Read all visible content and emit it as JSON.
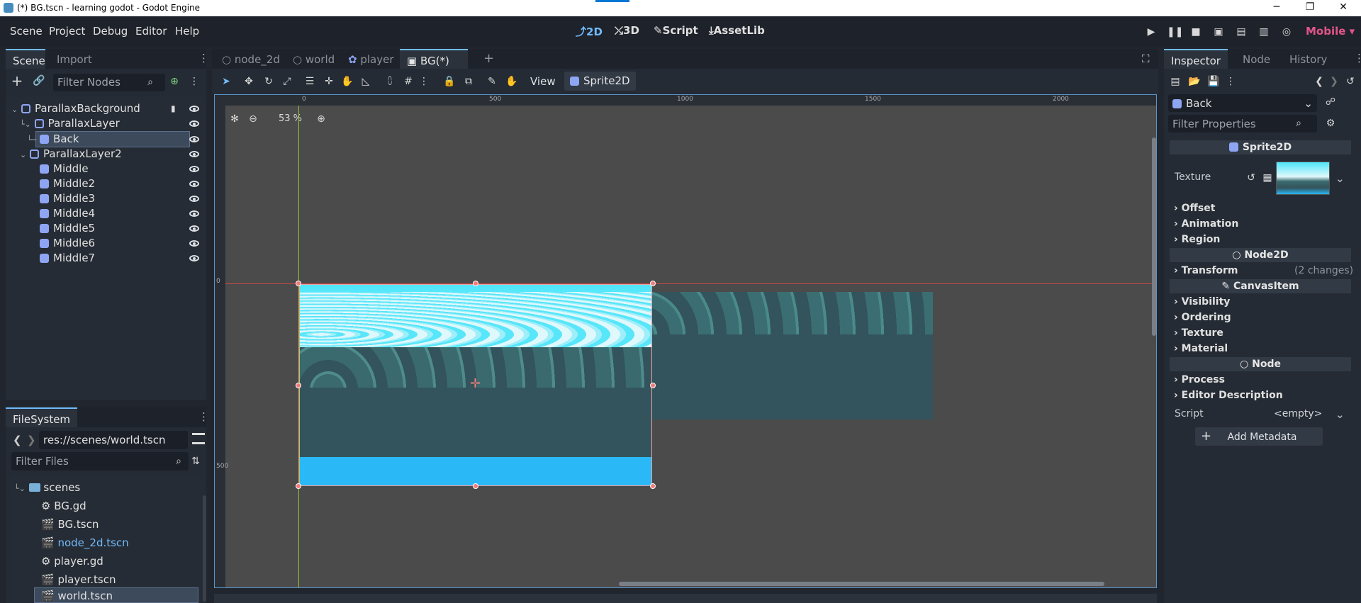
{
  "window": {
    "title": "(*) BG.tscn - learning godot - Godot Engine",
    "controls": [
      "─",
      "❐",
      "✕"
    ]
  },
  "menubar": {
    "menus": [
      "Scene",
      "Project",
      "Debug",
      "Editor",
      "Help"
    ],
    "modes": [
      "2D",
      "3D",
      "Script",
      "AssetLib"
    ],
    "renderer": "Mobile"
  },
  "scene_dock": {
    "tabs": [
      "Scene",
      "Import"
    ],
    "filter_placeholder": "Filter Nodes",
    "tree": [
      {
        "label": "ParallaxBackground"
      },
      {
        "label": "ParallaxLayer"
      },
      {
        "label": "Back"
      },
      {
        "label": "ParallaxLayer2"
      },
      {
        "label": "Middle"
      },
      {
        "label": "Middle2"
      },
      {
        "label": "Middle3"
      },
      {
        "label": "Middle4"
      },
      {
        "label": "Middle5"
      },
      {
        "label": "Middle6"
      },
      {
        "label": "Middle7"
      }
    ]
  },
  "filesystem": {
    "tab": "FileSystem",
    "path": "res://scenes/world.tscn",
    "filter_placeholder": "Filter Files",
    "items": [
      {
        "label": "scenes"
      },
      {
        "label": "BG.gd"
      },
      {
        "label": "BG.tscn"
      },
      {
        "label": "node_2d.tscn"
      },
      {
        "label": "player.gd"
      },
      {
        "label": "player.tscn"
      },
      {
        "label": "world.tscn"
      }
    ]
  },
  "editor_tabs": [
    "node_2d",
    "world",
    "player",
    "BG(*)"
  ],
  "toolbar": {
    "view_label": "View",
    "sprite_label": "Sprite2D"
  },
  "viewport": {
    "zoom": "53 %",
    "ruler_labels": [
      "0",
      "500",
      "1000",
      "1500",
      "2000"
    ],
    "vruler_labels": [
      "0",
      "500"
    ]
  },
  "inspector": {
    "tabs": [
      "Inspector",
      "Node",
      "History"
    ],
    "object_name": "Back",
    "filter_placeholder": "Filter Properties",
    "sections": {
      "sprite2d": "Sprite2D",
      "node2d": "Node2D",
      "canvasitem": "CanvasItem",
      "node": "Node"
    },
    "texture_label": "Texture",
    "sprite_props": [
      "Offset",
      "Animation",
      "Region"
    ],
    "transform_label": "Transform",
    "transform_changes": "(2 changes)",
    "canvas_props": [
      "Visibility",
      "Ordering",
      "Texture",
      "Material"
    ],
    "node_props": [
      "Process",
      "Editor Description"
    ],
    "script_label": "Script",
    "script_value": "<empty>",
    "add_metadata": "Add Metadata"
  },
  "colors": {
    "accent": "#70bafa",
    "node_icon": "#8da5f3",
    "selection": "#3d4a5c"
  }
}
